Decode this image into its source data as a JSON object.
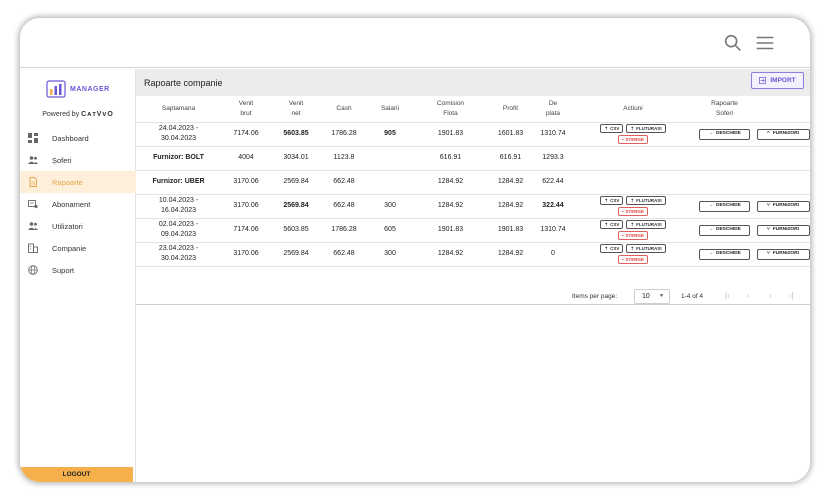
{
  "app": {
    "logo_text": "MANAGER",
    "powered_by": "Powered by",
    "powered_brand": "CᴀᴛVᴠO"
  },
  "colors": {
    "accent": "#6b57d6",
    "active_bg": "#fdefd9",
    "active_fg": "#e8a446",
    "logout": "#f5b04c",
    "danger": "#e04040"
  },
  "sidebar": {
    "items": [
      {
        "label": "Dashboard",
        "icon": "dashboard-icon"
      },
      {
        "label": "Șoferi",
        "icon": "people-icon"
      },
      {
        "label": "Rapoarte",
        "icon": "document-icon",
        "active": true
      },
      {
        "label": "Abonament",
        "icon": "subscription-icon"
      },
      {
        "label": "Utilizatori",
        "icon": "users-icon"
      },
      {
        "label": "Companie",
        "icon": "building-icon"
      },
      {
        "label": "Suport",
        "icon": "globe-icon"
      }
    ],
    "logout": "LOGOUT"
  },
  "main": {
    "title": "Rapoarte companie",
    "import": "IMPORT",
    "columns": {
      "week": "Saptamana",
      "gross_1": "Venit",
      "gross_2": "brut",
      "net_1": "Venit",
      "net_2": "net",
      "cash": "Cash",
      "salaries": "Salarii",
      "fee_1": "Comision",
      "fee_2": "Flota",
      "profit": "Profit",
      "due_1": "De",
      "due_2": "plata",
      "actions": "Actiuni",
      "driver_reports_1": "Rapoarte",
      "driver_reports_2": "Soferi"
    },
    "actions": {
      "csv": "CSV",
      "flutu": "FLUTURASI",
      "delete": "STERGE",
      "open": "DESCHIDE",
      "suppliers": "FURNIZORI"
    },
    "rows": [
      {
        "week_1": "24.04.2023 -",
        "week_2": "30.04.2023",
        "gross": "7174.06",
        "net": "5603.85",
        "cash": "1786.28",
        "salaries": "905",
        "fee": "1901.83",
        "profit": "1601.83",
        "due": "1310.74"
      },
      {
        "week_1": "10.04.2023 -",
        "week_2": "16.04.2023",
        "gross": "3170.06",
        "net": "2569.84",
        "cash": "662.48",
        "salaries": "300",
        "fee": "1284.92",
        "profit": "1284.92",
        "due": "322.44"
      },
      {
        "week_1": "02.04.2023 -",
        "week_2": "09.04.2023",
        "gross": "7174.06",
        "net": "5603.85",
        "cash": "1786.28",
        "salaries": "605",
        "fee": "1901.83",
        "profit": "1901.83",
        "due": "1310.74"
      },
      {
        "week_1": "23.04.2023 -",
        "week_2": "30.04.2023",
        "gross": "3170.06",
        "net": "2569.84",
        "cash": "662.48",
        "salaries": "300",
        "fee": "1284.92",
        "profit": "1284.92",
        "due": "0"
      }
    ],
    "suppliers": [
      {
        "name": "Furnizor: BOLT",
        "gross": "4004",
        "net": "3034.01",
        "cash": "1123.8",
        "fee": "616.91",
        "profit": "616.91",
        "due": "1293.3"
      },
      {
        "name": "Furnizor: UBER",
        "gross": "3170.06",
        "net": "2569.84",
        "cash": "662.48",
        "fee": "1284.92",
        "profit": "1284.92",
        "due": "622.44"
      }
    ],
    "paginator": {
      "label": "Items per page:",
      "size": "10",
      "range": "1-4 of 4"
    }
  }
}
